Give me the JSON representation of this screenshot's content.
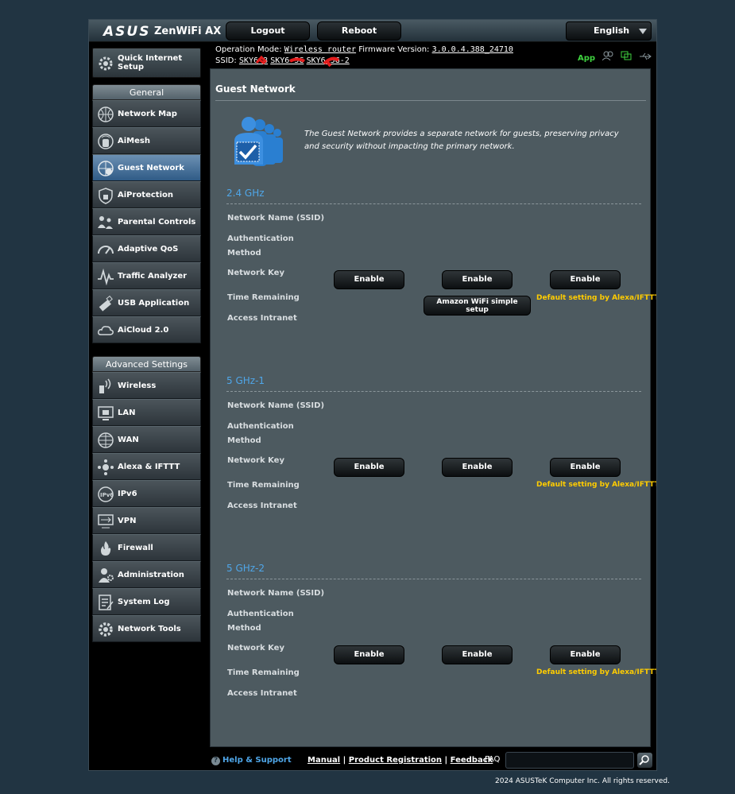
{
  "header": {
    "brand": "ASUS",
    "model": "ZenWiFi AX",
    "logout_label": "Logout",
    "reboot_label": "Reboot",
    "language": "English"
  },
  "status": {
    "operation_mode_label": "Operation Mode:",
    "operation_mode_value": "Wireless router",
    "firmware_label": "Firmware Version:",
    "firmware_value": "3.0.0.4.388_24710",
    "ssid_label": "SSID:",
    "ssids": [
      "SKY6    8",
      "SKY6      5G",
      "SKY6    5G-2"
    ],
    "app_label": "App",
    "icons": [
      "clients-icon",
      "network-icon",
      "usb-icon"
    ]
  },
  "sidebar": {
    "qis_label": "Quick Internet Setup",
    "general_header": "General",
    "general_items": [
      {
        "label": "Network Map",
        "icon": "network-map-icon"
      },
      {
        "label": "AiMesh",
        "icon": "aimesh-icon"
      },
      {
        "label": "Guest Network",
        "icon": "guest-network-icon",
        "active": true
      },
      {
        "label": "AiProtection",
        "icon": "aiprotection-icon"
      },
      {
        "label": "Parental Controls",
        "icon": "parental-controls-icon"
      },
      {
        "label": "Adaptive QoS",
        "icon": "adaptive-qos-icon"
      },
      {
        "label": "Traffic Analyzer",
        "icon": "traffic-analyzer-icon"
      },
      {
        "label": "USB Application",
        "icon": "usb-application-icon"
      },
      {
        "label": "AiCloud 2.0",
        "icon": "aicloud-icon"
      }
    ],
    "advanced_header": "Advanced Settings",
    "advanced_items": [
      {
        "label": "Wireless",
        "icon": "wireless-icon"
      },
      {
        "label": "LAN",
        "icon": "lan-icon"
      },
      {
        "label": "WAN",
        "icon": "wan-icon"
      },
      {
        "label": "Alexa & IFTTT",
        "icon": "alexa-ifttt-icon"
      },
      {
        "label": "IPv6",
        "icon": "ipv6-icon"
      },
      {
        "label": "VPN",
        "icon": "vpn-icon"
      },
      {
        "label": "Firewall",
        "icon": "firewall-icon"
      },
      {
        "label": "Administration",
        "icon": "administration-icon"
      },
      {
        "label": "System Log",
        "icon": "system-log-icon"
      },
      {
        "label": "Network Tools",
        "icon": "network-tools-icon"
      }
    ]
  },
  "main": {
    "title": "Guest Network",
    "description": "The Guest Network provides a separate network for guests, preserving privacy and security without impacting the primary network.",
    "field_labels": {
      "ssid": "Network Name (SSID)",
      "auth_line1": "Authentication",
      "auth_line2": "Method",
      "key": "Network Key",
      "time": "Time Remaining",
      "intranet": "Access Intranet"
    },
    "bands": [
      {
        "name": "2.4 GHz",
        "enable_labels": [
          "Enable",
          "Enable",
          "Enable"
        ],
        "amazon_label": "Amazon WiFi simple setup",
        "alexa_note": "Default setting by Alexa/IFTTT"
      },
      {
        "name": "5 GHz-1",
        "enable_labels": [
          "Enable",
          "Enable",
          "Enable"
        ],
        "alexa_note": "Default setting by Alexa/IFTTT"
      },
      {
        "name": "5 GHz-2",
        "enable_labels": [
          "Enable",
          "Enable",
          "Enable"
        ],
        "alexa_note": "Default setting by Alexa/IFTTT"
      }
    ]
  },
  "footer": {
    "help_label": "Help & Support",
    "manual_label": "Manual",
    "registration_label": "Product Registration",
    "feedback_label": "Feedback",
    "faq_label": "FAQ",
    "copyright": "2024 ASUSTeK Computer Inc. All rights reserved."
  },
  "colors": {
    "accent_blue": "#4fa6e8",
    "alexa_yellow": "#ffcc00",
    "app_green": "#3fd23f"
  }
}
